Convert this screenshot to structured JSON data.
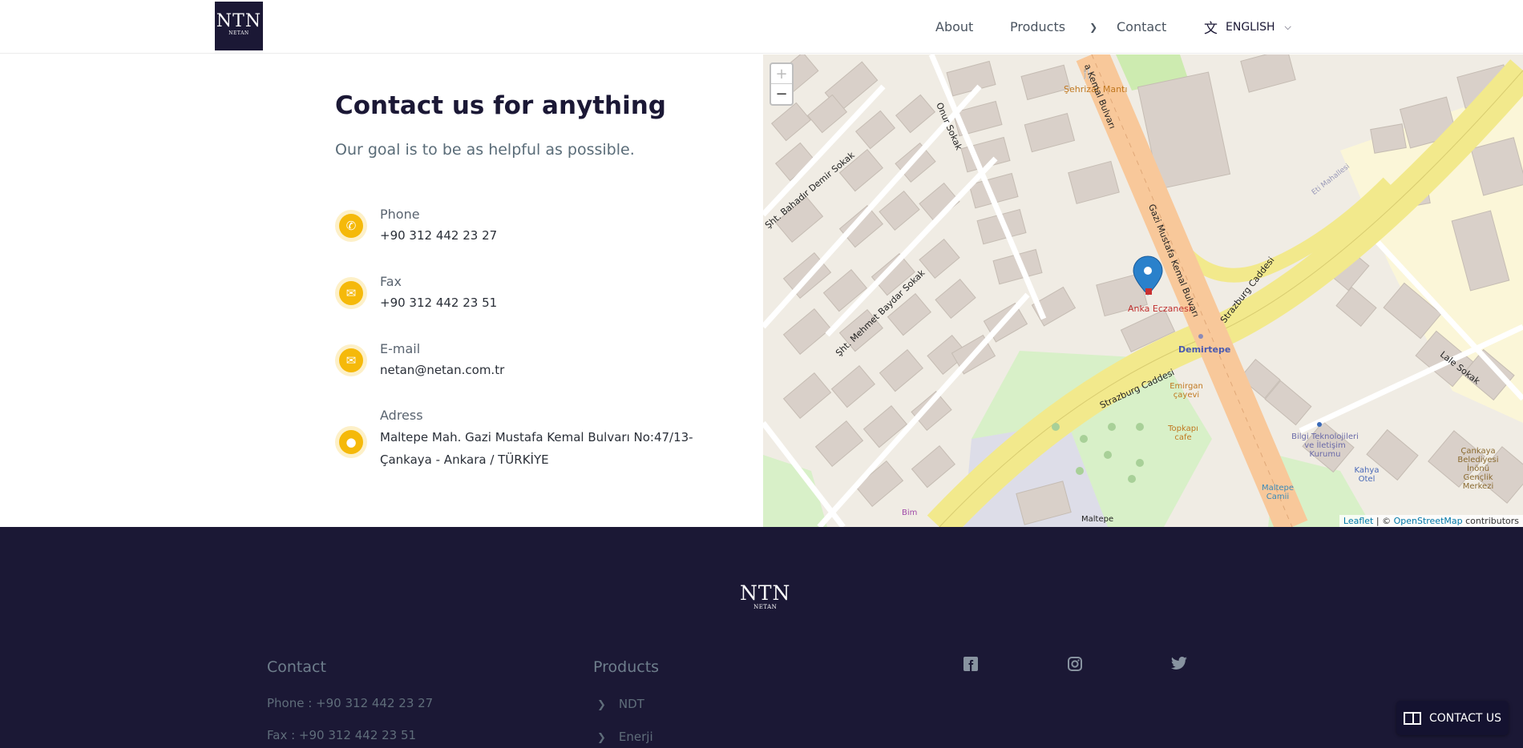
{
  "header": {
    "logo_big": "NTN",
    "logo_small": "NETAN",
    "nav": {
      "about": "About",
      "products": "Products",
      "contact": "Contact"
    },
    "language": "ENGLISH"
  },
  "contact": {
    "title": "Contact us for anything",
    "subtitle": "Our goal is to be as helpful as possible.",
    "items": [
      {
        "label": "Phone",
        "value": "+90 312 442 23 27",
        "icon": "phone-icon"
      },
      {
        "label": "Fax",
        "value": "+90 312 442 23 51",
        "icon": "envelope-icon"
      },
      {
        "label": "E-mail",
        "value": "netan@netan.com.tr",
        "icon": "envelope-icon"
      },
      {
        "label": "Adress",
        "value_line1": "Maltepe Mah. Gazi Mustafa Kemal Bulvarı No:47/13-",
        "value_line2": "Çankaya - Ankara / TÜRKİYE",
        "icon": "location-pin-icon"
      }
    ]
  },
  "map": {
    "zoom_in": "+",
    "zoom_out": "−",
    "attribution_leaflet": "Leaflet",
    "attribution_sep": " | © ",
    "attribution_osm": "OpenStreetMap",
    "attribution_rest": " contributors",
    "labels": {
      "gazi": "Gazi Mustafa Kemal Bulvarı",
      "kemal_top": "a Kemal Bulvarı",
      "onur": "Onur Sokak",
      "bahadir": "Şht. Bahadır Demir Sokak",
      "mehmet": "Şht. Mehmet Baydar Sokak",
      "strazburg1": "Strazburg Caddesi",
      "strazburg2": "Strazburg Caddesi",
      "lale": "Lale Sokak",
      "demirtepe": "Demirtepe",
      "anka": "Anka Eczanesi",
      "sehrizar": "Şehrizar Mantı",
      "emirgan": "Emirgan çayevi",
      "topkapi": "Topkapı cafe",
      "bilgi": "Bilgi Teknolojileri ve İletişim Kurumu",
      "kahya": "Kahya Otel",
      "cankaya": "Çankaya Belediyesi İnönü Gençlik Merkezi",
      "maltepe_cami": "Maltepe Camii",
      "maltepe": "Maltepe",
      "bim": "Bim",
      "eti": "Eti Mahallesi"
    }
  },
  "footer": {
    "logo_big": "NTN",
    "logo_small": "NETAN",
    "contact_title": "Contact",
    "phone": "Phone : +90 312 442 23 27",
    "fax": "Fax : +90 312 442 23 51",
    "products_title": "Products",
    "products": [
      "NDT",
      "Enerji"
    ],
    "social": [
      "facebook-icon",
      "instagram-icon",
      "twitter-icon"
    ],
    "cta": "CONTACT US"
  }
}
